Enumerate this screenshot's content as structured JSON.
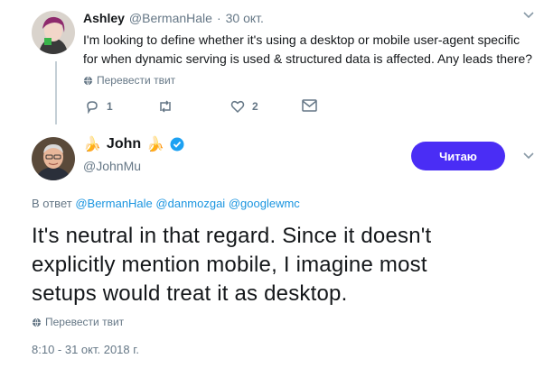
{
  "parent_tweet": {
    "name": "Ashley",
    "handle": "@BermanHale",
    "separator": "·",
    "date": "30 окт.",
    "text_line1": "I'm looking to define whether it's using a desktop or mobile user-agent specific",
    "text_line2": "for when dynamic serving is used & structured data is affected. Any leads there?",
    "translate_label": "Перевести твит",
    "actions": {
      "reply_count": "1",
      "retweet_count": "",
      "like_count": "2"
    }
  },
  "main_tweet": {
    "name": "John",
    "name_emoji_left": "🍌",
    "name_emoji_right": "🍌",
    "handle": "@JohnMu",
    "follow_button_label": "Читаю",
    "reply_to_prefix": "В ответ",
    "reply_to_mentions": [
      "@BermanHale",
      "@danmozgai",
      "@googlewmc"
    ],
    "text_line1": "It's neutral in that regard. Since it doesn't",
    "text_line2": "explicitly mention mobile, I imagine most",
    "text_line3": "setups would treat it as desktop.",
    "translate_label": "Перевести твит",
    "timestamp": "8:10 - 31 окт. 2018 г."
  },
  "colors": {
    "accent": "#1b95e0",
    "follow_button": "#4a2df5",
    "muted": "#657786"
  }
}
